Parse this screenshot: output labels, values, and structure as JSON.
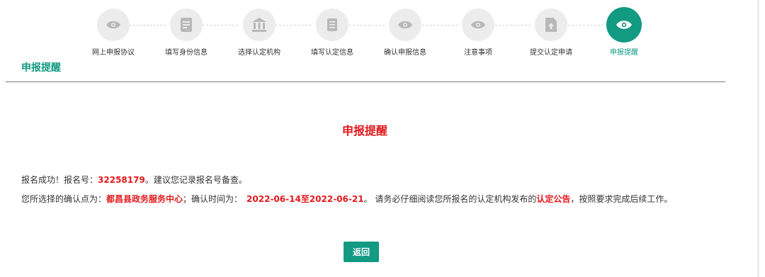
{
  "steps": [
    {
      "label": "网上申报协议",
      "icon": "eye-icon"
    },
    {
      "label": "填写身份信息",
      "icon": "document-icon"
    },
    {
      "label": "选择认定机构",
      "icon": "institution-icon"
    },
    {
      "label": "填写认定信息",
      "icon": "form-icon"
    },
    {
      "label": "确认申报信息",
      "icon": "eye-icon"
    },
    {
      "label": "注意事项",
      "icon": "eye-icon"
    },
    {
      "label": "提交认定申请",
      "icon": "upload-file-icon"
    },
    {
      "label": "申报提醒",
      "icon": "eye-icon",
      "active": true
    }
  ],
  "section_title": "申报提醒",
  "main_title": "申报提醒",
  "message": {
    "line1_prefix": "报名成功！报名号：",
    "registration_number": "32258179",
    "line1_suffix": "。建议您记录报名号备查。",
    "line2_prefix": "您所选择的确认点为：",
    "confirm_point": "都昌县政务服务中心",
    "line2_mid": "；确认时间为：",
    "confirm_period": "2022-06-14至2022-06-21",
    "line2_mid2": "。 请务必仔细阅读您所报名的认定机构发布的",
    "announcement": "认定公告",
    "line2_suffix": "，按照要求完成后续工作。"
  },
  "back_button": "返回",
  "colors": {
    "accent": "#129a82",
    "highlight": "#e3191c",
    "inactive": "#ececec"
  }
}
